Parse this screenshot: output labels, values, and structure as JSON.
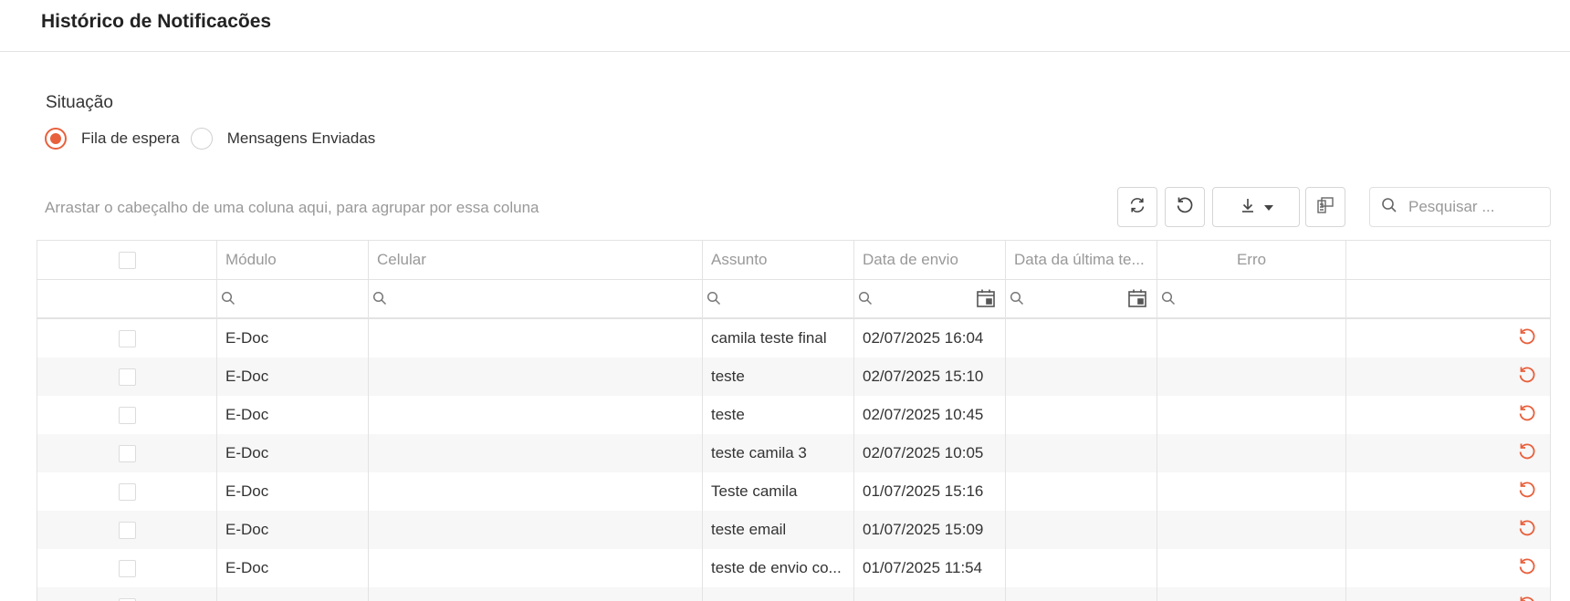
{
  "page": {
    "title": "Histórico de Notificacões"
  },
  "situacao": {
    "label": "Situação",
    "options": [
      {
        "label": "Fila de espera",
        "checked": true
      },
      {
        "label": "Mensagens Enviadas",
        "checked": false
      }
    ]
  },
  "group_panel": {
    "text": "Arrastar o cabeçalho de uma coluna aqui, para agrupar por essa coluna"
  },
  "toolbar": {
    "buttons": [
      "refresh-icon",
      "undo-icon",
      "download-icon",
      "column-chooser-icon"
    ],
    "search_placeholder": "Pesquisar ..."
  },
  "colors": {
    "accent": "#e8603c",
    "border": "#e3e3e3",
    "muted_text": "#999999"
  },
  "grid": {
    "columns": [
      "Módulo",
      "Celular",
      "Assunto",
      "Data de envio",
      "Data da última te...",
      "Erro"
    ],
    "rows": [
      {
        "modulo": "E-Doc",
        "celular": "",
        "assunto": "camila teste final",
        "data_envio": "02/07/2025 16:04",
        "data_ultima": "",
        "erro": ""
      },
      {
        "modulo": "E-Doc",
        "celular": "",
        "assunto": "teste",
        "data_envio": "02/07/2025 15:10",
        "data_ultima": "",
        "erro": ""
      },
      {
        "modulo": "E-Doc",
        "celular": "",
        "assunto": "teste",
        "data_envio": "02/07/2025 10:45",
        "data_ultima": "",
        "erro": ""
      },
      {
        "modulo": "E-Doc",
        "celular": "",
        "assunto": "teste camila 3",
        "data_envio": "02/07/2025 10:05",
        "data_ultima": "",
        "erro": ""
      },
      {
        "modulo": "E-Doc",
        "celular": "",
        "assunto": "Teste camila",
        "data_envio": "01/07/2025 15:16",
        "data_ultima": "",
        "erro": ""
      },
      {
        "modulo": "E-Doc",
        "celular": "",
        "assunto": "teste email",
        "data_envio": "01/07/2025 15:09",
        "data_ultima": "",
        "erro": ""
      },
      {
        "modulo": "E-Doc",
        "celular": "",
        "assunto": "teste de envio co...",
        "data_envio": "01/07/2025 11:54",
        "data_ultima": "",
        "erro": ""
      },
      {
        "modulo": "",
        "celular": "",
        "assunto": "",
        "data_envio": "",
        "data_ultima": "",
        "erro": ""
      }
    ]
  }
}
